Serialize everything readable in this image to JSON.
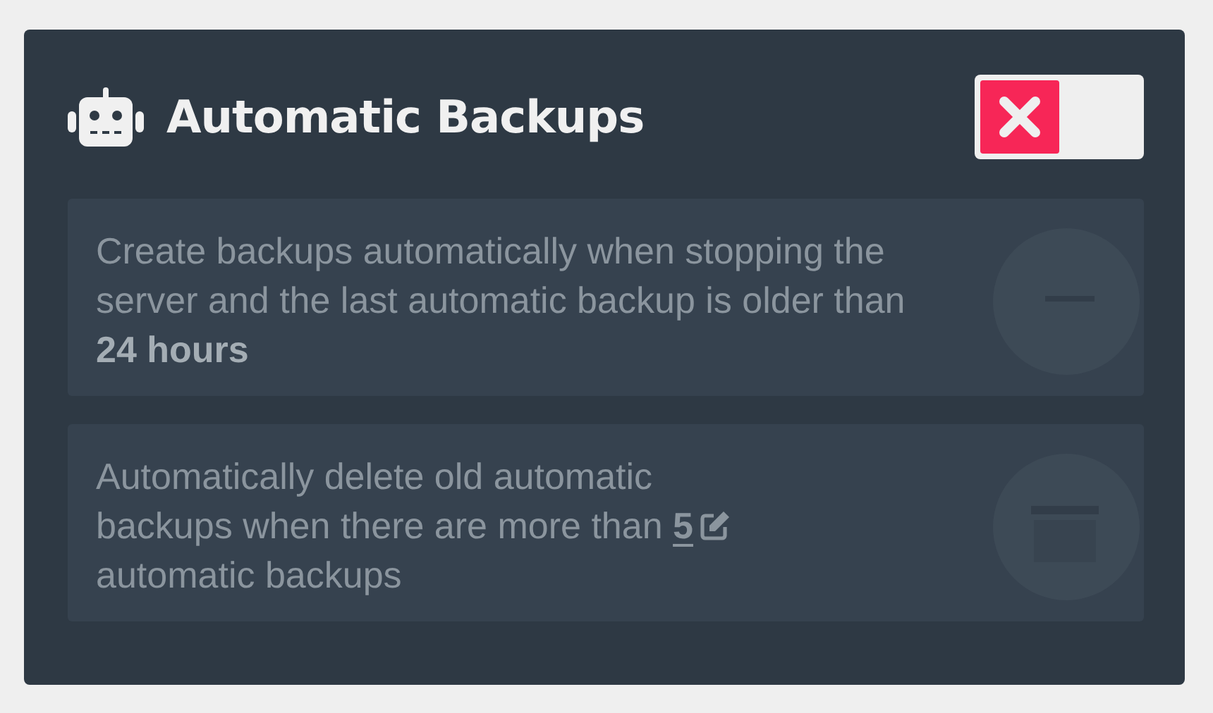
{
  "card": {
    "title": "Automatic Backups",
    "toggle": {
      "on": false
    }
  },
  "options": [
    {
      "kind": "text",
      "disabled": true,
      "text": "Create backups automatically when stopping the server and the last automatic backup is older than **24 hours**"
    },
    {
      "kind": "editable",
      "disabled": true,
      "before": [
        "Automatically delete old automatic",
        "backups when there are more than"
      ],
      "value": "5",
      "after": "automatic backups"
    }
  ]
}
